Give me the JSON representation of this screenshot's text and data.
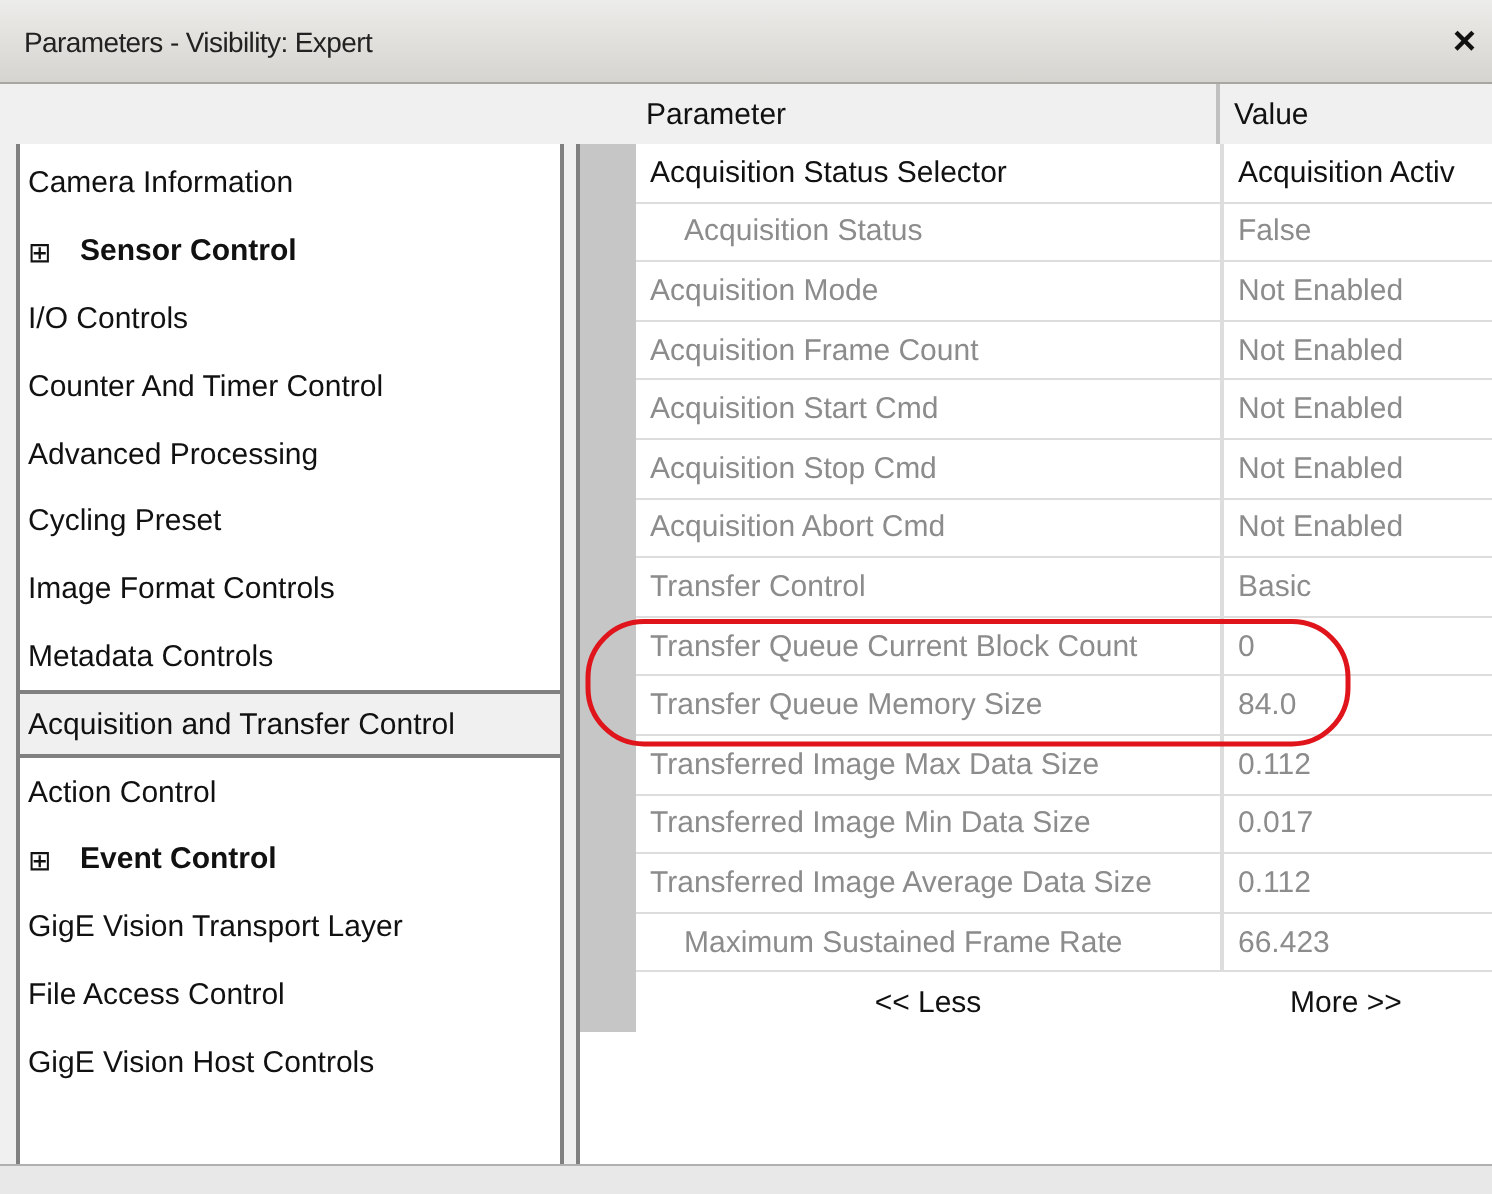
{
  "window": {
    "title": "Parameters - Visibility: Expert",
    "close": "×"
  },
  "sidebar": {
    "items": [
      {
        "label": "Camera Information",
        "kind": "item",
        "selected": false
      },
      {
        "label": "Sensor Control",
        "kind": "group",
        "expanded": false,
        "expander": "⊞",
        "selected": false
      },
      {
        "label": "I/O Controls",
        "kind": "item",
        "selected": false
      },
      {
        "label": "Counter And Timer Control",
        "kind": "item",
        "selected": false
      },
      {
        "label": "Advanced Processing",
        "kind": "item",
        "selected": false
      },
      {
        "label": "Cycling Preset",
        "kind": "item",
        "selected": false
      },
      {
        "label": "Image Format Controls",
        "kind": "item",
        "selected": false
      },
      {
        "label": "Metadata Controls",
        "kind": "item",
        "selected": false
      },
      {
        "label": "Acquisition and Transfer Control",
        "kind": "item",
        "selected": true
      },
      {
        "label": "Action Control",
        "kind": "item",
        "selected": false
      },
      {
        "label": "Event Control",
        "kind": "group",
        "expanded": false,
        "expander": "⊞",
        "selected": false
      },
      {
        "label": "GigE Vision Transport Layer",
        "kind": "item",
        "selected": false
      },
      {
        "label": "File Access Control",
        "kind": "item",
        "selected": false
      },
      {
        "label": "GigE Vision Host Controls",
        "kind": "item",
        "selected": false
      }
    ]
  },
  "table": {
    "columns": [
      "Parameter",
      "Value"
    ],
    "rows": [
      {
        "parameter": "Acquisition Status Selector",
        "value": "Acquisition Activ",
        "disabled": false,
        "indented": false,
        "circled": false
      },
      {
        "parameter": "Acquisition Status",
        "value": "False",
        "disabled": true,
        "indented": true,
        "circled": false
      },
      {
        "parameter": "Acquisition Mode",
        "value": "Not Enabled",
        "disabled": true,
        "indented": false,
        "circled": false
      },
      {
        "parameter": "Acquisition Frame Count",
        "value": "Not Enabled",
        "disabled": true,
        "indented": false,
        "circled": false
      },
      {
        "parameter": "Acquisition Start Cmd",
        "value": "Not Enabled",
        "disabled": true,
        "indented": false,
        "circled": false
      },
      {
        "parameter": "Acquisition Stop Cmd",
        "value": "Not Enabled",
        "disabled": true,
        "indented": false,
        "circled": false
      },
      {
        "parameter": "Acquisition Abort Cmd",
        "value": "Not Enabled",
        "disabled": true,
        "indented": false,
        "circled": false
      },
      {
        "parameter": "Transfer Control",
        "value": "Basic",
        "disabled": true,
        "indented": false,
        "circled": false
      },
      {
        "parameter": "Transfer Queue Current Block Count",
        "value": "0",
        "disabled": true,
        "indented": false,
        "circled": true
      },
      {
        "parameter": "Transfer Queue Memory Size",
        "value": "84.0",
        "disabled": true,
        "indented": false,
        "circled": true
      },
      {
        "parameter": "Transferred Image Max Data Size",
        "value": "0.112",
        "disabled": true,
        "indented": false,
        "circled": false
      },
      {
        "parameter": "Transferred Image Min Data Size",
        "value": "0.017",
        "disabled": true,
        "indented": false,
        "circled": false
      },
      {
        "parameter": "Transferred Image Average Data Size",
        "value": "0.112",
        "disabled": true,
        "indented": false,
        "circled": false
      },
      {
        "parameter": "Maximum Sustained Frame Rate",
        "value": "66.423",
        "disabled": true,
        "indented": true,
        "circled": false
      }
    ],
    "less": "<< Less",
    "more": "More >>"
  }
}
